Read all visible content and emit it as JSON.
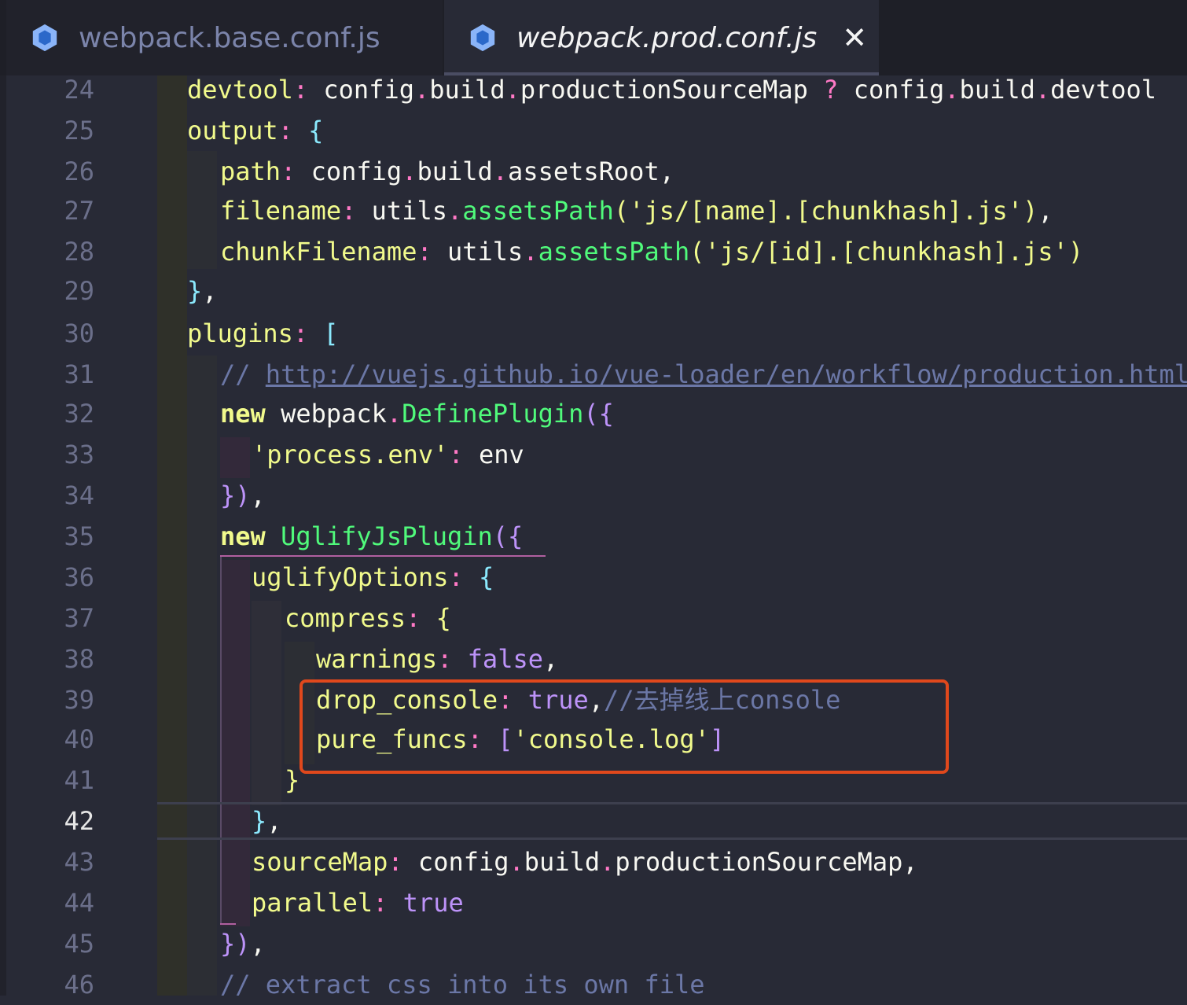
{
  "tabs": [
    {
      "label": "webpack.base.conf.js",
      "active": false
    },
    {
      "label": "webpack.prod.conf.js",
      "active": true
    }
  ],
  "close_glyph": "✕",
  "active_line": 42,
  "lines": [
    {
      "n": "24"
    },
    {
      "n": "25"
    },
    {
      "n": "26"
    },
    {
      "n": "27"
    },
    {
      "n": "28"
    },
    {
      "n": "29"
    },
    {
      "n": "30"
    },
    {
      "n": "31"
    },
    {
      "n": "32"
    },
    {
      "n": "33"
    },
    {
      "n": "34"
    },
    {
      "n": "35"
    },
    {
      "n": "36"
    },
    {
      "n": "37"
    },
    {
      "n": "38"
    },
    {
      "n": "39"
    },
    {
      "n": "40"
    },
    {
      "n": "41"
    },
    {
      "n": "42"
    },
    {
      "n": "43"
    },
    {
      "n": "44"
    },
    {
      "n": "45"
    },
    {
      "n": "46"
    }
  ],
  "code": {
    "l24": {
      "a": "devtool",
      "b": ":",
      "c": " config",
      "d": ".",
      "e": "build",
      "f": ".",
      "g": "productionSourceMap",
      "h": " ? ",
      "i": "config",
      "j": ".",
      "k": "build",
      "l": ".",
      "m": "devtool"
    },
    "l25": {
      "a": "output",
      "b": ":",
      "c": " {"
    },
    "l26": {
      "a": "path",
      "b": ":",
      "c": " config",
      "d": ".",
      "e": "build",
      "f": ".",
      "g": "assetsRoot,"
    },
    "l27": {
      "a": "filename",
      "b": ":",
      "c": " utils",
      "d": ".",
      "e": "assetsPath",
      "f": "(",
      "g": "'js/[name].[chunkhash].js'",
      "h": ")",
      "i": ","
    },
    "l28": {
      "a": "chunkFilename",
      "b": ":",
      "c": " utils",
      "d": ".",
      "e": "assetsPath",
      "f": "(",
      "g": "'js/[id].[chunkhash].js'",
      "h": ")"
    },
    "l29": {
      "a": "}",
      "b": ","
    },
    "l30": {
      "a": "plugins",
      "b": ":",
      "c": " ["
    },
    "l31": {
      "a": "// ",
      "b": "http://vuejs.github.io/vue-loader/en/workflow/production.html"
    },
    "l32": {
      "a": "new",
      "b": " webpack",
      "c": ".",
      "d": "DefinePlugin",
      "e": "({"
    },
    "l33": {
      "a": "'process.env'",
      "b": ":",
      "c": " env"
    },
    "l34": {
      "a": "})",
      "b": ","
    },
    "l35": {
      "a": "new",
      "b": " UglifyJsPlugin",
      "c": "({"
    },
    "l36": {
      "a": "uglifyOptions",
      "b": ":",
      "c": " {"
    },
    "l37": {
      "a": "compress",
      "b": ":",
      "c": " {"
    },
    "l38": {
      "a": "warnings",
      "b": ":",
      "c": " false",
      "d": ","
    },
    "l39": {
      "a": "drop_console",
      "b": ":",
      "c": " true",
      "d": ",",
      "e": "//去掉线上console"
    },
    "l40": {
      "a": "pure_funcs",
      "b": ":",
      "c": " [",
      "d": "'console.log'",
      "e": "]"
    },
    "l41": {
      "a": "}"
    },
    "l42": {
      "a": "}",
      "b": ","
    },
    "l43": {
      "a": "sourceMap",
      "b": ":",
      "c": " config",
      "d": ".",
      "e": "build",
      "f": ".",
      "g": "productionSourceMap",
      "h": ","
    },
    "l44": {
      "a": "parallel",
      "b": ":",
      "c": " true"
    },
    "l45": {
      "a": "})",
      "b": ","
    },
    "l46": {
      "a": "// extract css into its own file"
    }
  }
}
